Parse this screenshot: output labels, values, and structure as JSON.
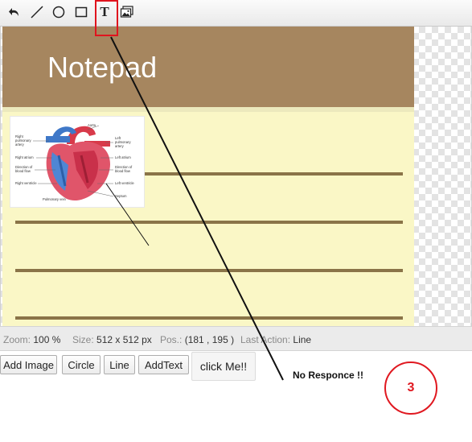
{
  "toolbar": {
    "tools": [
      {
        "name": "undo",
        "icon": "undo-arrow-icon"
      },
      {
        "name": "line",
        "icon": "line-icon"
      },
      {
        "name": "circle",
        "icon": "circle-icon"
      },
      {
        "name": "rectangle",
        "icon": "rectangle-icon"
      },
      {
        "name": "text",
        "icon": "text-tool-icon",
        "glyph": "T"
      },
      {
        "name": "image",
        "icon": "image-icon"
      }
    ],
    "selected_tool": "text"
  },
  "canvas": {
    "notepad_title": "Notepad",
    "heart_labels": {
      "aorta": "Aorta",
      "right_pulmonary_artery": "Right pulmonary artery",
      "left_pulmonary_artery": "Left pulmonary artery",
      "right_atrium": "Right atrium",
      "left_atrium": "Left atrium",
      "direction_blood_flow": "Direction of blood flow",
      "right_ventricle": "Right ventricle",
      "left_ventricle": "Left ventricle",
      "septum": "Septum",
      "pulmonary_vein": "Pulmonary vein"
    }
  },
  "status": {
    "zoom_label": "Zoom:",
    "zoom_value": "100 %",
    "size_label": "Size:",
    "size_value": "512 x 512 px",
    "pos_label": "Pos.:",
    "pos_value": "(181 , 195 )",
    "last_action_label": "Last Action:",
    "last_action_value": "Line"
  },
  "buttons": {
    "add_image": "Add Image",
    "circle": "Circle",
    "line": "Line",
    "add_text": "AddText",
    "click_me": "click Me!!"
  },
  "annotation": {
    "no_response": "No Responce !!",
    "number": "3",
    "color": "#e01820"
  },
  "colors": {
    "header_brown": "#a6865f",
    "paper_yellow": "#faf7c6",
    "rule_brown": "#8a7448"
  }
}
